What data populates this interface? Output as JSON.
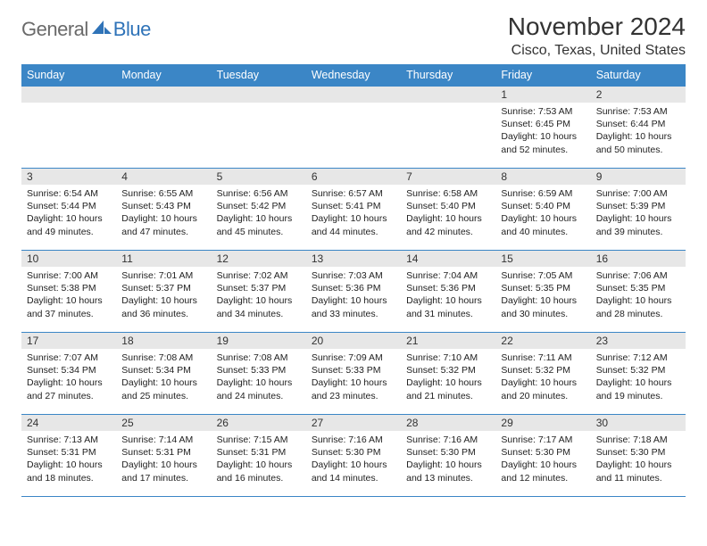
{
  "logo": {
    "general": "General",
    "blue": "Blue"
  },
  "title": "November 2024",
  "location": "Cisco, Texas, United States",
  "weekdays": [
    "Sunday",
    "Monday",
    "Tuesday",
    "Wednesday",
    "Thursday",
    "Friday",
    "Saturday"
  ],
  "weeks": [
    [
      null,
      null,
      null,
      null,
      null,
      {
        "n": "1",
        "sunrise": "7:53 AM",
        "sunset": "6:45 PM",
        "daylight": "10 hours and 52 minutes."
      },
      {
        "n": "2",
        "sunrise": "7:53 AM",
        "sunset": "6:44 PM",
        "daylight": "10 hours and 50 minutes."
      }
    ],
    [
      {
        "n": "3",
        "sunrise": "6:54 AM",
        "sunset": "5:44 PM",
        "daylight": "10 hours and 49 minutes."
      },
      {
        "n": "4",
        "sunrise": "6:55 AM",
        "sunset": "5:43 PM",
        "daylight": "10 hours and 47 minutes."
      },
      {
        "n": "5",
        "sunrise": "6:56 AM",
        "sunset": "5:42 PM",
        "daylight": "10 hours and 45 minutes."
      },
      {
        "n": "6",
        "sunrise": "6:57 AM",
        "sunset": "5:41 PM",
        "daylight": "10 hours and 44 minutes."
      },
      {
        "n": "7",
        "sunrise": "6:58 AM",
        "sunset": "5:40 PM",
        "daylight": "10 hours and 42 minutes."
      },
      {
        "n": "8",
        "sunrise": "6:59 AM",
        "sunset": "5:40 PM",
        "daylight": "10 hours and 40 minutes."
      },
      {
        "n": "9",
        "sunrise": "7:00 AM",
        "sunset": "5:39 PM",
        "daylight": "10 hours and 39 minutes."
      }
    ],
    [
      {
        "n": "10",
        "sunrise": "7:00 AM",
        "sunset": "5:38 PM",
        "daylight": "10 hours and 37 minutes."
      },
      {
        "n": "11",
        "sunrise": "7:01 AM",
        "sunset": "5:37 PM",
        "daylight": "10 hours and 36 minutes."
      },
      {
        "n": "12",
        "sunrise": "7:02 AM",
        "sunset": "5:37 PM",
        "daylight": "10 hours and 34 minutes."
      },
      {
        "n": "13",
        "sunrise": "7:03 AM",
        "sunset": "5:36 PM",
        "daylight": "10 hours and 33 minutes."
      },
      {
        "n": "14",
        "sunrise": "7:04 AM",
        "sunset": "5:36 PM",
        "daylight": "10 hours and 31 minutes."
      },
      {
        "n": "15",
        "sunrise": "7:05 AM",
        "sunset": "5:35 PM",
        "daylight": "10 hours and 30 minutes."
      },
      {
        "n": "16",
        "sunrise": "7:06 AM",
        "sunset": "5:35 PM",
        "daylight": "10 hours and 28 minutes."
      }
    ],
    [
      {
        "n": "17",
        "sunrise": "7:07 AM",
        "sunset": "5:34 PM",
        "daylight": "10 hours and 27 minutes."
      },
      {
        "n": "18",
        "sunrise": "7:08 AM",
        "sunset": "5:34 PM",
        "daylight": "10 hours and 25 minutes."
      },
      {
        "n": "19",
        "sunrise": "7:08 AM",
        "sunset": "5:33 PM",
        "daylight": "10 hours and 24 minutes."
      },
      {
        "n": "20",
        "sunrise": "7:09 AM",
        "sunset": "5:33 PM",
        "daylight": "10 hours and 23 minutes."
      },
      {
        "n": "21",
        "sunrise": "7:10 AM",
        "sunset": "5:32 PM",
        "daylight": "10 hours and 21 minutes."
      },
      {
        "n": "22",
        "sunrise": "7:11 AM",
        "sunset": "5:32 PM",
        "daylight": "10 hours and 20 minutes."
      },
      {
        "n": "23",
        "sunrise": "7:12 AM",
        "sunset": "5:32 PM",
        "daylight": "10 hours and 19 minutes."
      }
    ],
    [
      {
        "n": "24",
        "sunrise": "7:13 AM",
        "sunset": "5:31 PM",
        "daylight": "10 hours and 18 minutes."
      },
      {
        "n": "25",
        "sunrise": "7:14 AM",
        "sunset": "5:31 PM",
        "daylight": "10 hours and 17 minutes."
      },
      {
        "n": "26",
        "sunrise": "7:15 AM",
        "sunset": "5:31 PM",
        "daylight": "10 hours and 16 minutes."
      },
      {
        "n": "27",
        "sunrise": "7:16 AM",
        "sunset": "5:30 PM",
        "daylight": "10 hours and 14 minutes."
      },
      {
        "n": "28",
        "sunrise": "7:16 AM",
        "sunset": "5:30 PM",
        "daylight": "10 hours and 13 minutes."
      },
      {
        "n": "29",
        "sunrise": "7:17 AM",
        "sunset": "5:30 PM",
        "daylight": "10 hours and 12 minutes."
      },
      {
        "n": "30",
        "sunrise": "7:18 AM",
        "sunset": "5:30 PM",
        "daylight": "10 hours and 11 minutes."
      }
    ]
  ],
  "labels": {
    "sunrise": "Sunrise: ",
    "sunset": "Sunset: ",
    "daylight": "Daylight: "
  }
}
